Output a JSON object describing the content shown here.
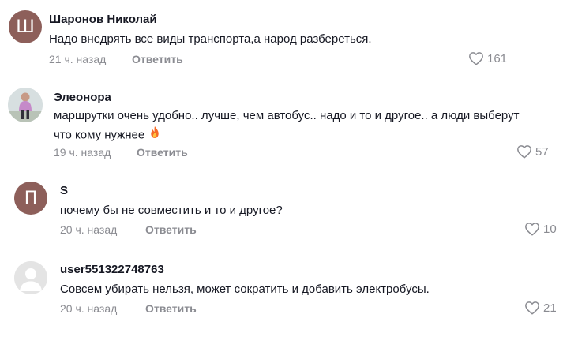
{
  "comments": [
    {
      "avatar_letter": "Ш",
      "username": "Шаронов Николай",
      "text": "Надо внедрять все виды транспорта,а народ разбереться.",
      "time": "21 ч. назад",
      "reply_label": "Ответить",
      "likes": "161"
    },
    {
      "username": "Элеонора",
      "text_line1": "маршрутки очень удобно.. лучше, чем автобус.. надо и то и другое.. а люди выберут",
      "text_line2": "что кому нужнее",
      "time": "19 ч. назад",
      "reply_label": "Ответить",
      "likes": "57"
    },
    {
      "avatar_letter": "П",
      "username": "S",
      "text": "почему бы не совместить и то и другое?",
      "time": "20 ч. назад",
      "reply_label": "Ответить",
      "likes": "10"
    },
    {
      "username": "user551322748763",
      "text": "Совсем убирать нельзя, может сократить и добавить электробусы.",
      "time": "20 ч. назад",
      "reply_label": "Ответить",
      "likes": "21"
    }
  ],
  "colors": {
    "text_primary": "#161823",
    "text_secondary": "#8a8b91",
    "avatar_letter_bg": "#8d5f5a",
    "avatar_default_bg": "#e4e4e4"
  },
  "icons": {
    "like": "heart-icon",
    "emoji": "fire-icon"
  }
}
